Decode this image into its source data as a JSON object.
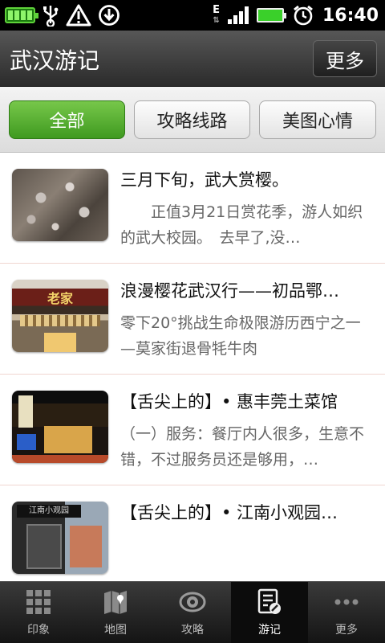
{
  "status_bar": {
    "time": "16:40"
  },
  "header": {
    "title": "武汉游记",
    "more_button": "更多"
  },
  "filters": {
    "all": "全部",
    "route": "攻略线路",
    "photo": "美图心情"
  },
  "items": [
    {
      "title": "三月下旬，武大赏樱。",
      "desc": "　　正值3月21日赏花季，游人如织的武大校园。　去早了,没…"
    },
    {
      "title": "浪漫樱花武汉行——初品鄂…",
      "desc": "零下20°挑战生命极限游历西宁之一—莫家街退骨牦牛肉"
    },
    {
      "title": "【舌尖上的】• 惠丰莞土菜馆",
      "desc": "（一）服务：餐厅内人很多，生意不错，不过服务员还是够用，…"
    },
    {
      "title": "【舌尖上的】• 江南小观园…",
      "desc": ""
    }
  ],
  "thumb_text": {
    "item2_sign": "老家",
    "item4_sign": "江南小观园"
  },
  "bottom_nav": [
    {
      "label": "印象",
      "icon": "grid-icon"
    },
    {
      "label": "地图",
      "icon": "map-icon"
    },
    {
      "label": "攻略",
      "icon": "eye-icon"
    },
    {
      "label": "游记",
      "icon": "note-edit-icon"
    },
    {
      "label": "更多",
      "icon": "more-dots-icon"
    }
  ],
  "active_tab": "游记"
}
